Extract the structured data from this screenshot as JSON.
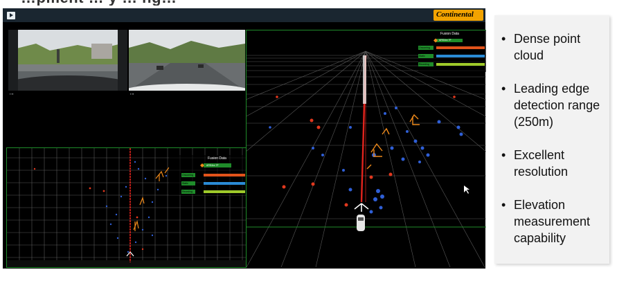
{
  "header": {
    "partial_title": "…pment … y … ng…"
  },
  "toolbar": {
    "play_button": "play-icon",
    "brand_label": "Continental"
  },
  "fusion_panel": {
    "title": "Fusion Data",
    "source": "ARS4xx 7F",
    "rows": [
      {
        "label": "Oncoming",
        "color": "#e2531b",
        "level": 0.6
      },
      {
        "label": "Static",
        "color": "#2a8bd6",
        "level": 0.6
      },
      {
        "label": "Receding",
        "color": "#9ec92a",
        "level": 0.6
      }
    ]
  },
  "bullets": [
    {
      "text": "Dense point cloud"
    },
    {
      "text": "Leading edge detection range (250m)"
    },
    {
      "text": "Excellent resolution"
    },
    {
      "text": "Elevation measurement capability"
    }
  ],
  "colors": {
    "grid": "#5a5a5a",
    "frame": "#1f8c2a",
    "points_blue": "#2f5fd6",
    "points_red": "#e0381e",
    "tracks": "#f08a1a",
    "center_line": "#e3241d"
  }
}
